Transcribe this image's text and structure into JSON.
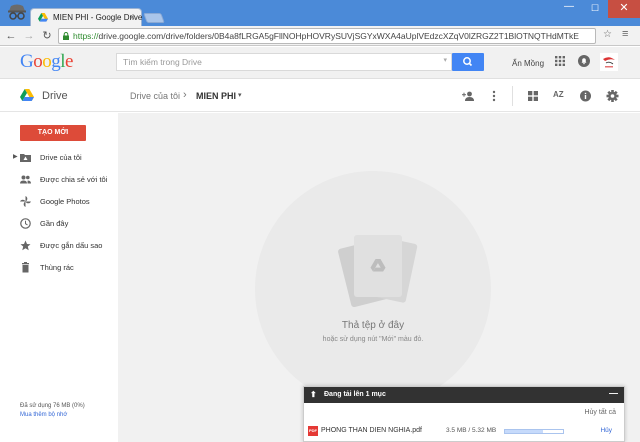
{
  "browser": {
    "tab_title": "MIEN PHI - Google Drive",
    "tab_close": "×",
    "window_controls": {
      "minimize": "—",
      "maximize": "☐",
      "close": "✕"
    },
    "nav": {
      "back": "←",
      "forward": "→",
      "reload": "↻"
    },
    "url_scheme": "https://",
    "url_rest": "drive.google.com/drive/folders/0B4a8fLRGA5gFllNOHpHOVRySUVjSGYxWXA4aUplVEdzcXZqV0lZRGZ2T1BlOTNQTHdMTkE",
    "star": "☆",
    "menu": "≡"
  },
  "google_bar": {
    "logo": [
      "G",
      "o",
      "o",
      "g",
      "l",
      "e"
    ],
    "search_placeholder": "Tìm kiếm trong Drive",
    "search_dropdown": "▾",
    "user_name": "Ẩn Mồng"
  },
  "drive_header": {
    "app_name": "Drive",
    "breadcrumb_parent": "Drive của tôi",
    "breadcrumb_sep": "›",
    "breadcrumb_current": "MIEN PHI",
    "current_caret": "▾",
    "sort_label": "AZ"
  },
  "sidebar": {
    "new_button": "TẠO MỚI",
    "items": [
      {
        "label": "Drive của tôi",
        "icon": "my-drive-icon"
      },
      {
        "label": "Được chia sẻ với tôi",
        "icon": "shared-icon"
      },
      {
        "label": "Google Photos",
        "icon": "photos-icon"
      },
      {
        "label": "Gần đây",
        "icon": "clock-icon"
      },
      {
        "label": "Được gắn dấu sao",
        "icon": "star-icon"
      },
      {
        "label": "Thùng rác",
        "icon": "trash-icon"
      }
    ],
    "expand_arrow": "▶",
    "storage_text": "Đã sử dụng 76 MB (0%)",
    "buy_storage": "Mua thêm bộ nhớ"
  },
  "main": {
    "drop_title": "Thả tệp ở đây",
    "drop_subtitle": "hoặc sử dụng nút \"Mới\" màu đỏ."
  },
  "upload_panel": {
    "title": "Đang tải lên 1 mục",
    "up_arrow": "⬆",
    "minimize": "—",
    "cancel_all": "Hủy tất cả",
    "file": {
      "type_label": "PDF",
      "name": "PHONG THAN DIEN NGHIA.pdf",
      "size": "3.5 MB / 5.32 MB",
      "progress": 0.66,
      "cancel": "Hủy"
    }
  },
  "colors": {
    "accent_red": "#dd4b39",
    "accent_blue": "#4285f4",
    "chrome_blue": "#4b8ad8"
  }
}
